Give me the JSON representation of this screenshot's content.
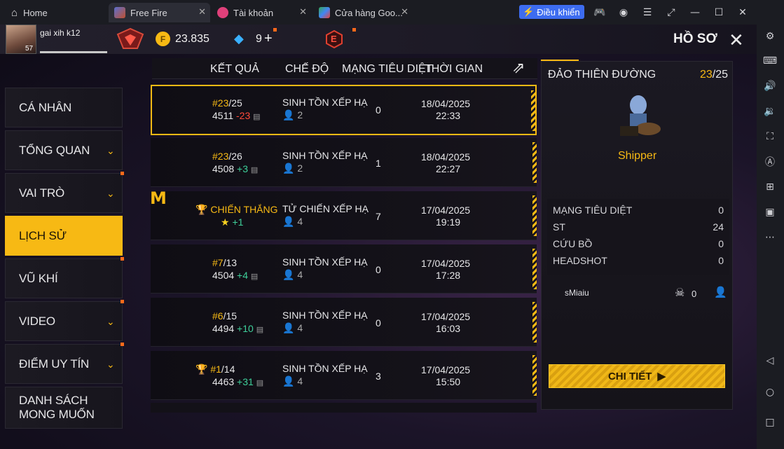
{
  "browser": {
    "tabs": [
      {
        "label": "Home"
      },
      {
        "label": "Free Fire"
      },
      {
        "label": "Tài khoản"
      },
      {
        "label": "Cửa hàng Goo..."
      }
    ],
    "control_button": "Điều khiển",
    "colors": {
      "bar": "#1b1c22",
      "accent": "#3d6cf0"
    }
  },
  "player": {
    "name": "gai xih k12",
    "level": "57",
    "gold": "23.835",
    "diamonds": "9",
    "rank_letter": "E"
  },
  "page_title": "HỒ SƠ",
  "menu": [
    {
      "label": "CÁ NHÂN"
    },
    {
      "label": "TỔNG QUAN"
    },
    {
      "label": "VAI TRÒ"
    },
    {
      "label": "LỊCH SỬ"
    },
    {
      "label": "VŨ KHÍ"
    },
    {
      "label": "VIDEO"
    },
    {
      "label": "ĐIỂM UY TÍN"
    },
    {
      "label": "DANH SÁCH MONG MUỐN"
    }
  ],
  "table": {
    "headers": [
      "KẾT QUẢ",
      "CHẾ ĐỘ",
      "MẠNG TIÊU DIỆT",
      "THỜI GIAN"
    ],
    "rows": [
      {
        "rank": "#23",
        "total": "/25",
        "score": "4511",
        "delta": "-23",
        "mode": "SINH TỒN XẾP HẠ",
        "squad": "2",
        "kills": "0",
        "date": "18/04/2025",
        "time": "22:33"
      },
      {
        "rank": "#23",
        "total": "/26",
        "score": "4508",
        "delta": "+3",
        "mode": "SINH TỒN XẾP HẠ",
        "squad": "2",
        "kills": "1",
        "date": "18/04/2025",
        "time": "22:27"
      },
      {
        "rank": "CHIẾN THẮNG",
        "total": "",
        "score": "★",
        "delta": "+1",
        "mode": "TỬ CHIẾN XẾP HẠ",
        "squad": "4",
        "kills": "7",
        "date": "17/04/2025",
        "time": "19:19"
      },
      {
        "rank": "#7",
        "total": "/13",
        "score": "4504",
        "delta": "+4",
        "mode": "SINH TỒN XẾP HẠ",
        "squad": "4",
        "kills": "0",
        "date": "17/04/2025",
        "time": "17:28"
      },
      {
        "rank": "#6",
        "total": "/15",
        "score": "4494",
        "delta": "+10",
        "mode": "SINH TỒN XẾP HẠ",
        "squad": "4",
        "kills": "0",
        "date": "17/04/2025",
        "time": "16:03"
      },
      {
        "rank": "#1",
        "total": "/14",
        "score": "4463",
        "delta": "+31",
        "mode": "SINH TỒN XẾP HẠ",
        "squad": "4",
        "kills": "3",
        "date": "17/04/2025",
        "time": "15:50"
      }
    ]
  },
  "detail": {
    "map": "ĐẢO THIÊN ĐƯỜNG",
    "rank": "23",
    "rank_total": "/25",
    "character": "Shipper",
    "stats": [
      {
        "label": "MẠNG TIÊU DIỆT",
        "value": "0"
      },
      {
        "label": "ST",
        "value": "24"
      },
      {
        "label": "CỨU BỒ",
        "value": "0"
      },
      {
        "label": "HEADSHOT",
        "value": "0"
      }
    ],
    "teammate": "sMiaiu",
    "teammate_kills": "0",
    "detail_button": "CHI TIẾT"
  }
}
